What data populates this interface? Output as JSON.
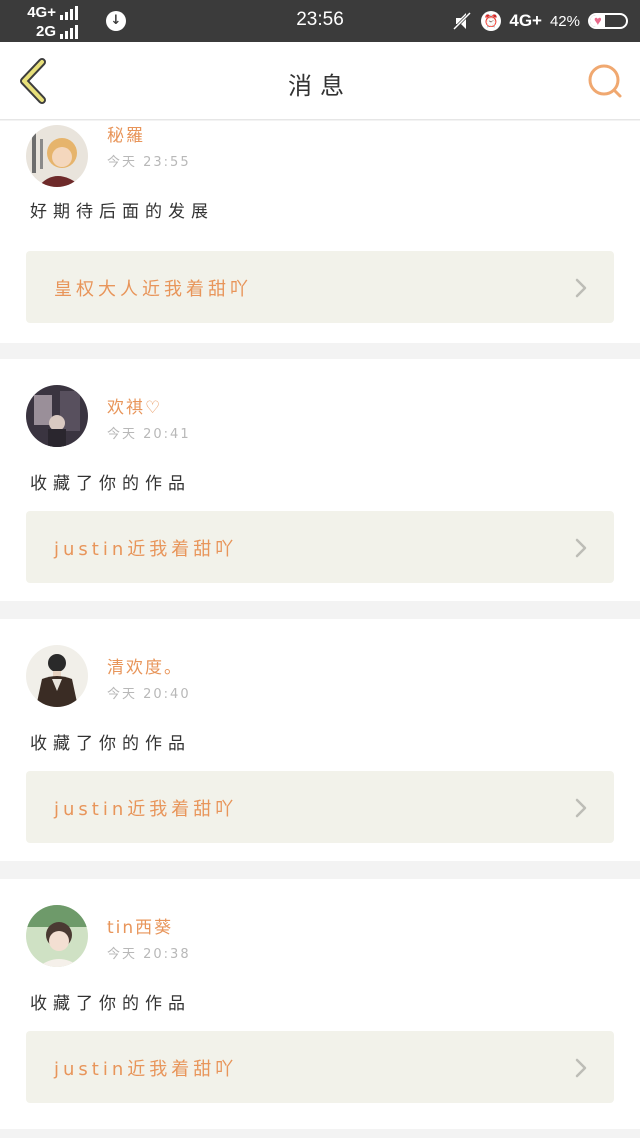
{
  "status_bar": {
    "network_top": "4G+",
    "network_bottom": "2G",
    "time": "23:56",
    "network_right": "4G+",
    "battery_percent": "42%",
    "battery_level": 0.42
  },
  "header": {
    "title": "消息"
  },
  "colors": {
    "accent": "#e8955a",
    "back_arrow": "#c9b04a",
    "card_link_bg": "#f2f2ea",
    "divider_bg": "#f3f3f3"
  },
  "feed": [
    {
      "username": "秘羅",
      "timestamp": "今天 23:55",
      "message": "好期待后面的发展",
      "work_title": "皇权大人近我着甜吖"
    },
    {
      "username": "欢祺♡",
      "timestamp": "今天 20:41",
      "message": "收藏了你的作品",
      "work_title": "justin近我着甜吖"
    },
    {
      "username": "清欢度。",
      "timestamp": "今天 20:40",
      "message": "收藏了你的作品",
      "work_title": "justin近我着甜吖"
    },
    {
      "username": "tin西葵",
      "timestamp": "今天 20:38",
      "message": "收藏了你的作品",
      "work_title": "justin近我着甜吖"
    }
  ]
}
